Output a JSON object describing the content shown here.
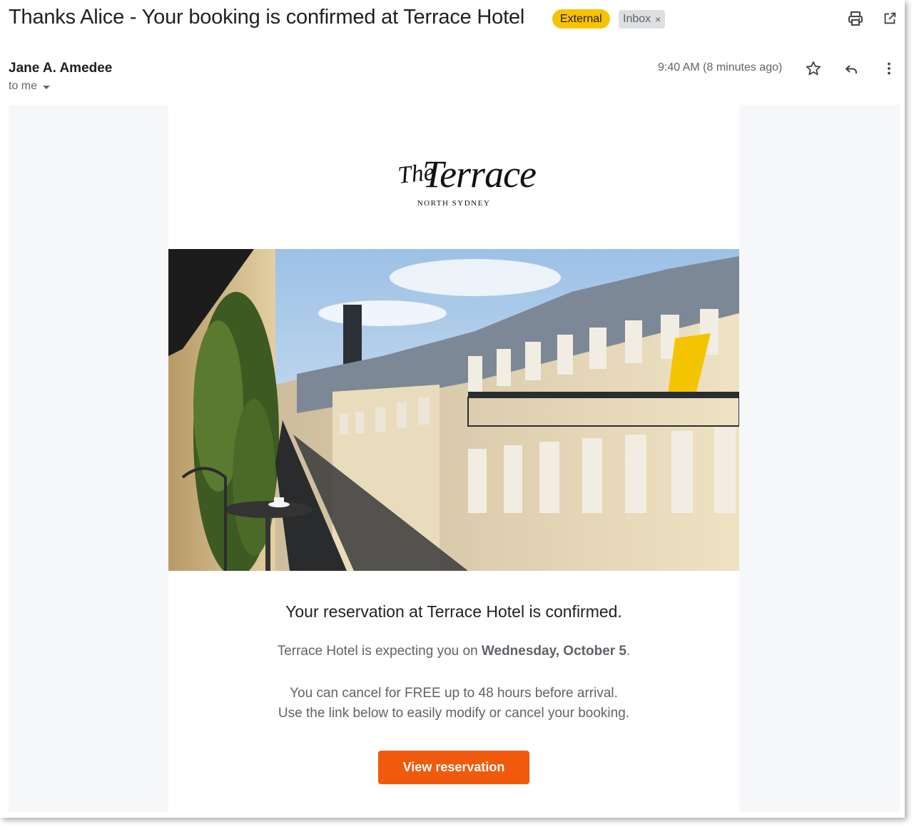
{
  "email": {
    "subject": "Thanks Alice - Your booking is confirmed at Terrace Hotel",
    "labels": {
      "external": "External",
      "inbox": "Inbox",
      "remove_icon": "×"
    },
    "sender": "Jane A. Amedee",
    "recipient": "to me",
    "timestamp": "9:40 AM (8 minutes ago)",
    "actions": [
      "print-icon",
      "open-in-new-window-icon",
      "star-icon",
      "reply-icon",
      "more-vertical-icon"
    ]
  },
  "message": {
    "logo": {
      "the": "The",
      "name": "Terrace",
      "location": "NORTH SYDNEY"
    },
    "hero_image": "balcony-street-view",
    "headline": "Your reservation at Terrace Hotel is confirmed.",
    "expecting_prefix": "Terrace Hotel is expecting you on ",
    "expecting_date": "Wednesday, October 5",
    "expecting_suffix": ".",
    "cancel_line1": "You can cancel for FREE up to 48 hours before arrival.",
    "cancel_line2": "Use the link below to easily modify or cancel your booking.",
    "cta_label": "View reservation"
  },
  "colors": {
    "external_badge": "#f9c200",
    "inbox_badge": "#dedfe1",
    "cta": "#f15a0c",
    "body_background": "#f6f7f9"
  }
}
